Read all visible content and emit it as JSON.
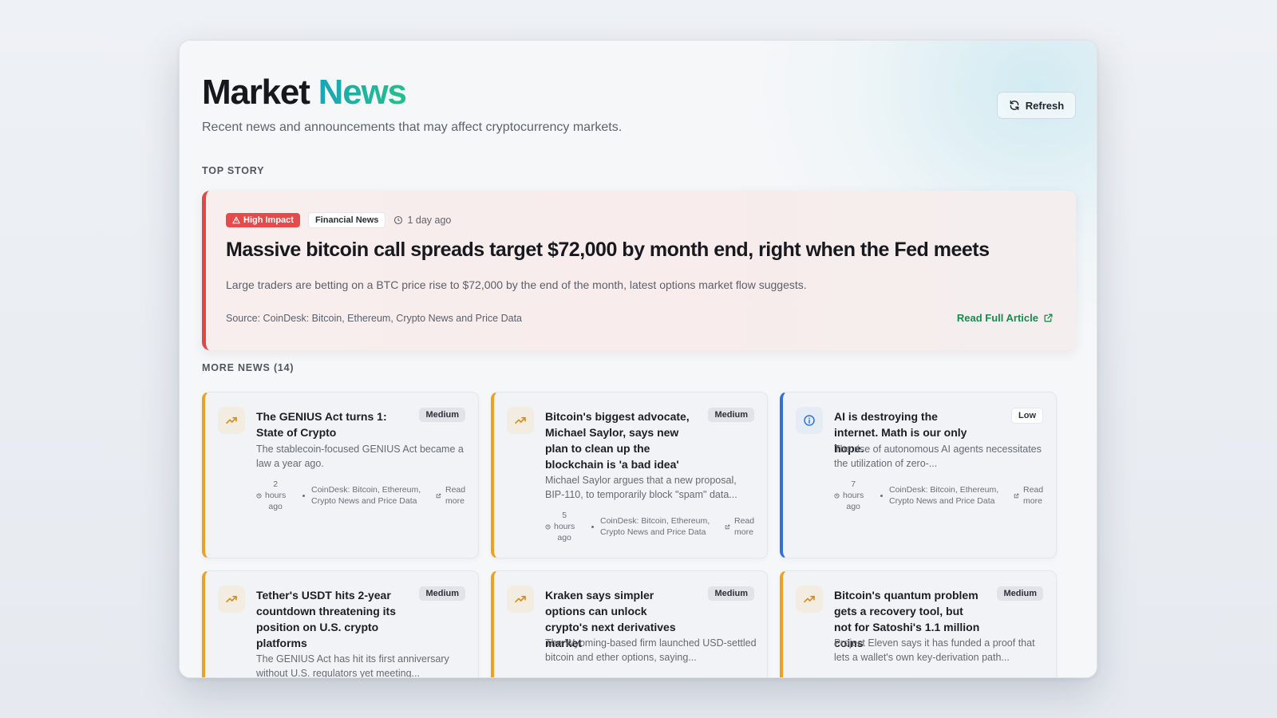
{
  "header": {
    "title_main": "Market",
    "title_accent": "News",
    "subtitle": "Recent news and announcements that may affect cryptocurrency markets.",
    "refresh_label": "Refresh"
  },
  "top_story": {
    "section_label": "TOP STORY",
    "impact_label": "High Impact",
    "category": "Financial News",
    "time": "1 day ago",
    "headline": "Massive bitcoin call spreads target $72,000 by month end, right when the Fed meets",
    "description": "Large traders are betting on a BTC price rise to $72,000 by the end of the month, latest options market flow suggests.",
    "source": "Source: CoinDesk: Bitcoin, Ethereum, Crypto News and Price Data",
    "read_label": "Read Full Article"
  },
  "more_news": {
    "section_label": "MORE NEWS (14)",
    "items": [
      {
        "title": "The GENIUS Act turns 1: State of Crypto",
        "impact": "Medium",
        "icon": "trending-up-icon",
        "description": "The stablecoin-focused GENIUS Act became a law a year ago.",
        "time_num": "2",
        "time_unit": "hours",
        "time_ago": "ago",
        "source": "CoinDesk: Bitcoin, Ethereum, Crypto News and Price Data",
        "read_1": "Read",
        "read_2": "more"
      },
      {
        "title": "Bitcoin's biggest advocate, Michael Saylor, says new plan to clean up the blockchain is 'a bad idea'",
        "impact": "Medium",
        "icon": "trending-up-icon",
        "description": "Michael Saylor argues that a new proposal, BIP-110, to temporarily block \"spam\" data...",
        "time_num": "5",
        "time_unit": "hours",
        "time_ago": "ago",
        "source": "CoinDesk: Bitcoin, Ethereum, Crypto News and Price Data",
        "read_1": "Read",
        "read_2": "more"
      },
      {
        "title": "AI is destroying the internet. Math is our only hope.",
        "impact": "Low",
        "icon": "info-icon",
        "description": "The rise of autonomous AI agents necessitates the utilization of zero-...",
        "time_num": "7",
        "time_unit": "hours",
        "time_ago": "ago",
        "source": "CoinDesk: Bitcoin, Ethereum, Crypto News and Price Data",
        "read_1": "Read",
        "read_2": "more"
      },
      {
        "title": "Tether's USDT hits 2-year countdown threatening its position on U.S. crypto platforms",
        "impact": "Medium",
        "icon": "trending-up-icon",
        "description": "The GENIUS Act has hit its first anniversary without U.S. regulators yet meeting..."
      },
      {
        "title": "Kraken says simpler options can unlock crypto's next derivatives market",
        "impact": "Medium",
        "icon": "trending-up-icon",
        "description": "The Wyoming-based firm launched USD-settled bitcoin and ether options, saying..."
      },
      {
        "title": "Bitcoin's quantum problem gets a recovery tool, but not for Satoshi's 1.1 million coins",
        "impact": "Medium",
        "icon": "trending-up-icon",
        "description": "Project Eleven says it has funded a proof that lets a wallet's own key-derivation path..."
      }
    ]
  },
  "colors": {
    "accent_teal": "#1aa5b8",
    "high_impact": "#e44b4b",
    "medium_border": "#f0a020",
    "low_border": "#2f72d8",
    "read_link": "#1a8a4e"
  }
}
